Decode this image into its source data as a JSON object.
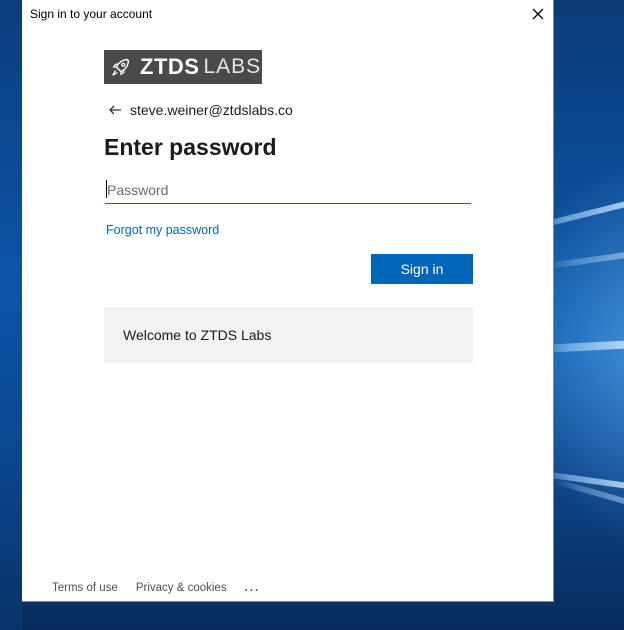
{
  "window": {
    "title": "Sign in to your account"
  },
  "brand": {
    "bold": "ZTDS",
    "light": "LABS"
  },
  "identity": {
    "email": "steve.weiner@ztdslabs.co"
  },
  "heading": "Enter password",
  "password_field": {
    "placeholder": "Password",
    "value": ""
  },
  "links": {
    "forgot": "Forgot my password"
  },
  "buttons": {
    "sign_in": "Sign in"
  },
  "welcome": {
    "text": "Welcome to ZTDS Labs"
  },
  "footer": {
    "terms": "Terms of use",
    "privacy": "Privacy & cookies",
    "more": "..."
  },
  "colors": {
    "accent": "#0067b8",
    "logo_bg": "#4a4a4a",
    "welcome_bg": "#f2f2f2"
  },
  "icons": {
    "close": "close-icon",
    "back": "back-arrow-icon",
    "logo": "rocket-icon"
  }
}
